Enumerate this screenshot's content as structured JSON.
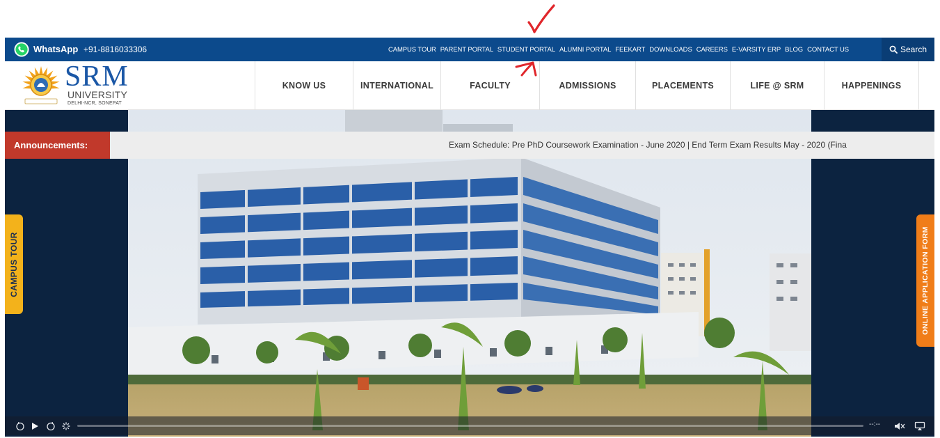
{
  "topbar": {
    "whatsapp_label": "WhatsApp",
    "phone": "+91-8816033306",
    "links": [
      "CAMPUS TOUR",
      "PARENT PORTAL",
      "STUDENT PORTAL",
      "ALUMNI PORTAL",
      "FEEKART",
      "DOWNLOADS",
      "CAREERS",
      "E-VARSITY ERP",
      "BLOG",
      "CONTACT US"
    ],
    "search_label": "Search"
  },
  "logo": {
    "name": "SRM",
    "subtitle": "UNIVERSITY",
    "location": "DELHI-NCR, SONEPAT"
  },
  "nav": {
    "items": [
      "KNOW US",
      "INTERNATIONAL",
      "FACULTY",
      "ADMISSIONS",
      "PLACEMENTS",
      "LIFE @ SRM",
      "HAPPENINGS"
    ]
  },
  "announcements": {
    "label": "Announcements:",
    "ticker": "Exam Schedule: Pre PhD Coursework Examination - June 2020 | End Term Exam Results May - 2020 (Fina"
  },
  "side_tabs": {
    "left": "CAMPUS TOUR",
    "right": "ONLINE APPLICATION FORM"
  },
  "video": {
    "time": "--:--"
  },
  "colors": {
    "topbar": "#0c4a8c",
    "announcement_label": "#c1392b",
    "campus_tour_tab": "#f3b21b",
    "application_tab": "#f07d19",
    "hero_side": "#0c2340",
    "annotation": "#e0262b"
  }
}
